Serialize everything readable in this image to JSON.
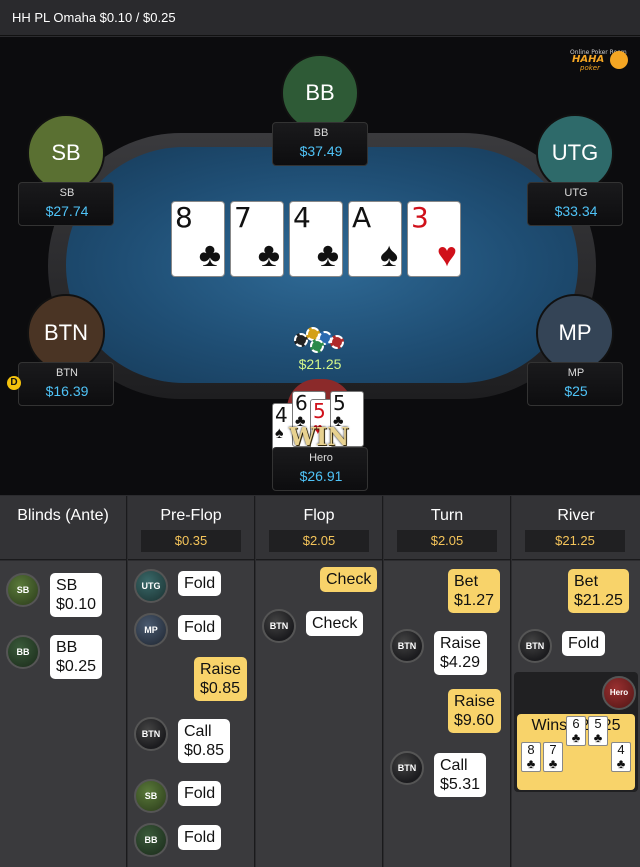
{
  "title": "HH PL Omaha $0.10 / $0.25",
  "logo": {
    "tagline": "Online Poker Room",
    "brand": "HAHA",
    "sub": "poker"
  },
  "seats": {
    "bb": {
      "label": "BB",
      "name": "BB",
      "stack": "$37.49",
      "color": "#2e5a36"
    },
    "sb": {
      "label": "SB",
      "name": "SB",
      "stack": "$27.74",
      "color": "#5a7032"
    },
    "utg": {
      "label": "UTG",
      "name": "UTG",
      "stack": "$33.34",
      "color": "#2e6a6a"
    },
    "btn": {
      "label": "BTN",
      "name": "BTN",
      "stack": "$16.39",
      "color": "#4a3424"
    },
    "mp": {
      "label": "MP",
      "name": "MP",
      "stack": "$25",
      "color": "#344456"
    },
    "hero": {
      "name": "Hero",
      "stack": "$26.91"
    }
  },
  "dealer_button": "D",
  "board": [
    {
      "rank": "8",
      "suit": "♣",
      "color": "black"
    },
    {
      "rank": "7",
      "suit": "♣",
      "color": "black"
    },
    {
      "rank": "4",
      "suit": "♣",
      "color": "black"
    },
    {
      "rank": "A",
      "suit": "♠",
      "color": "black"
    },
    {
      "rank": "3",
      "suit": "♥",
      "color": "red"
    }
  ],
  "pot": "$21.25",
  "hero_cards": [
    {
      "rank": "4",
      "suit": "♠",
      "color": "black"
    },
    {
      "rank": "6",
      "suit": "♣",
      "color": "black"
    },
    {
      "rank": "5",
      "suit": "♥",
      "color": "red"
    },
    {
      "rank": "5",
      "suit": "♣",
      "color": "black"
    }
  ],
  "win_label": "WIN",
  "streets": {
    "blinds": {
      "title": "Blinds (Ante)",
      "pot": ""
    },
    "preflop": {
      "title": "Pre-Flop",
      "pot": "$0.35"
    },
    "flop": {
      "title": "Flop",
      "pot": "$2.05"
    },
    "turn": {
      "title": "Turn",
      "pot": "$2.05"
    },
    "river": {
      "title": "River",
      "pot": "$21.25"
    }
  },
  "actions": {
    "blinds": [
      {
        "pos": "SB",
        "text1": "SB",
        "text2": "$0.10"
      },
      {
        "pos": "BB",
        "text1": "BB",
        "text2": "$0.25"
      }
    ],
    "preflop": [
      {
        "pos": "UTG",
        "text1": "Fold"
      },
      {
        "pos": "MP",
        "text1": "Fold"
      },
      {
        "text1": "Raise",
        "text2": "$0.85"
      },
      {
        "pos": "BTN",
        "text1": "Call",
        "text2": "$0.85"
      },
      {
        "pos": "SB",
        "text1": "Fold"
      },
      {
        "pos": "BB",
        "text1": "Fold"
      }
    ],
    "flop": [
      {
        "text1": "Check"
      },
      {
        "pos": "BTN",
        "text1": "Check"
      }
    ],
    "turn": [
      {
        "text1": "Bet",
        "text2": "$1.27"
      },
      {
        "pos": "BTN",
        "text1": "Raise",
        "text2": "$4.29"
      },
      {
        "text1": "Raise",
        "text2": "$9.60"
      },
      {
        "pos": "BTN",
        "text1": "Call",
        "text2": "$5.31"
      }
    ],
    "river": [
      {
        "text1": "Bet",
        "text2": "$21.25"
      },
      {
        "pos": "BTN",
        "text1": "Fold"
      }
    ]
  },
  "winner": {
    "pos": "Hero",
    "text": "Wins $21.25",
    "cards": [
      {
        "rank": "8",
        "suit": "♣"
      },
      {
        "rank": "7",
        "suit": "♣"
      },
      {
        "rank": "6",
        "suit": "♣"
      },
      {
        "rank": "5",
        "suit": "♣"
      },
      {
        "rank": "4",
        "suit": "♣"
      }
    ]
  }
}
